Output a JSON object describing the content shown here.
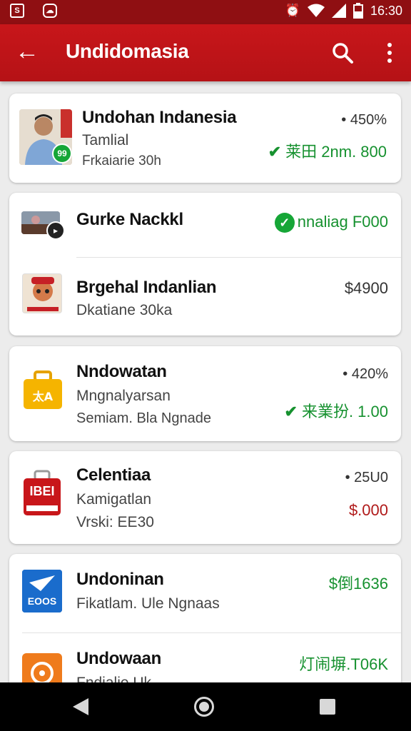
{
  "status_bar": {
    "time": "16:30"
  },
  "app_bar": {
    "title": "Undidomasia"
  },
  "cards": [
    {
      "rows": [
        {
          "name": "Undohan Indanesia",
          "sub1": "Tamlial",
          "sub2": "Frkaiarie 30h",
          "pct": "• 450%",
          "value": "莱田 2nm. 800",
          "icon": "person-photo-thumbnail"
        }
      ]
    },
    {
      "rows": [
        {
          "name": "Gurke Nackkl",
          "value": "nnaliag F000",
          "icon": "video-thumbnail"
        },
        {
          "name": "Brgehal Indanlian",
          "sub1": "Dkatiane 30ka",
          "value": "$4900",
          "icon": "red-mascot-icon"
        }
      ]
    },
    {
      "rows": [
        {
          "name": "Nndowatan",
          "sub1": "Mngnalyarsan",
          "sub2": "Semiam. Bla Ngnade",
          "pct": "• 420%",
          "value": "来業扮. 1.00",
          "icon": "yellow-bag-icon"
        }
      ]
    },
    {
      "rows": [
        {
          "name": "Celentiaa",
          "sub1": "Kamigatlan",
          "sub2": "Vrski: EE30",
          "pct": "• 25U0",
          "value": "$.000",
          "icon": "red-box-icon",
          "icon_text": "IBEI"
        }
      ]
    },
    {
      "rows": [
        {
          "name": "Undoninan",
          "sub1": "Fikatlam. Ule Ngnaas",
          "value": "$倒1636",
          "icon": "blue-plane-icon",
          "icon_text": "EOOS"
        },
        {
          "name": "Undowaan",
          "sub1": "Fndialie Uk",
          "value": "灯闹塀.T06K",
          "icon": "orange-app-icon"
        }
      ]
    }
  ],
  "colors": {
    "primary": "#c8161a",
    "status_bar": "#8f0f12",
    "positive": "#16912f",
    "negative": "#b01a1a"
  }
}
